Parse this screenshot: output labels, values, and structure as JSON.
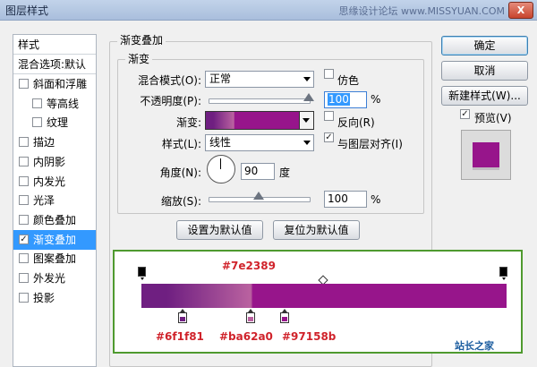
{
  "window": {
    "title": "图层样式",
    "watermark": "思缘设计论坛 www.MISSYUAN.COM",
    "close_glyph": "X"
  },
  "style_list": {
    "header": "样式",
    "blend_options": "混合选项:默认",
    "items": [
      {
        "label": "斜面和浮雕",
        "checked": false,
        "indent": false
      },
      {
        "label": "等高线",
        "checked": false,
        "indent": true
      },
      {
        "label": "纹理",
        "checked": false,
        "indent": true
      },
      {
        "label": "描边",
        "checked": false,
        "indent": false
      },
      {
        "label": "内阴影",
        "checked": false,
        "indent": false
      },
      {
        "label": "内发光",
        "checked": false,
        "indent": false
      },
      {
        "label": "光泽",
        "checked": false,
        "indent": false
      },
      {
        "label": "颜色叠加",
        "checked": false,
        "indent": false
      },
      {
        "label": "渐变叠加",
        "checked": true,
        "indent": false,
        "selected": true
      },
      {
        "label": "图案叠加",
        "checked": false,
        "indent": false
      },
      {
        "label": "外发光",
        "checked": false,
        "indent": false
      },
      {
        "label": "投影",
        "checked": false,
        "indent": false
      }
    ],
    "check_glyph": "✓"
  },
  "panel": {
    "group_title": "渐变叠加",
    "subgroup_title": "渐变",
    "blend_mode_label": "混合模式(O):",
    "blend_mode_value": "正常",
    "dither_label": "仿色",
    "opacity_label": "不透明度(P):",
    "opacity_value": "100",
    "opacity_unit": "%",
    "opacity_level": 1.0,
    "gradient_label": "渐变:",
    "reverse_label": "反向(R)",
    "style_label": "样式(L):",
    "style_value": "线性",
    "align_label": "与图层对齐(I)",
    "align_checked": true,
    "angle_label": "角度(N):",
    "angle_value": "90",
    "angle_unit": "度",
    "scale_label": "缩放(S):",
    "scale_value": "100",
    "scale_unit": "%",
    "scale_level": 0.5,
    "set_default_button": "设置为默认值",
    "reset_default_button": "复位为默认值"
  },
  "buttons": {
    "ok": "确定",
    "cancel": "取消",
    "new_style": "新建样式(W)...",
    "preview_label": "预览(V)",
    "preview_checked": true
  },
  "gradient_editor": {
    "stops": [
      {
        "color": "#6f1f81",
        "label": "#6f1f81"
      },
      {
        "color": "#ba62a0",
        "label": "#ba62a0"
      },
      {
        "color": "#97158b",
        "label": "#97158b"
      }
    ],
    "top_label": "#7e2389"
  },
  "colors": {
    "gradient_start": "#6f1f81",
    "gradient_mid": "#ba62a0",
    "gradient_end": "#97158b",
    "annotation": "#d0232b",
    "highlight_border": "#4f9a2f"
  },
  "footer_logo": "站长之家"
}
